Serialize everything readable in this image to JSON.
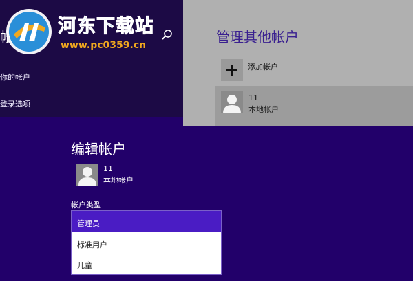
{
  "sidebar": {
    "title": "帐户",
    "items": [
      {
        "label": "你的帐户"
      },
      {
        "label": "登录选项"
      }
    ]
  },
  "watermark": {
    "title": "河东下载站",
    "url": "www.pc0359.cn"
  },
  "manage": {
    "heading": "管理其他帐户",
    "add_label": "添加帐户",
    "accounts": [
      {
        "name": "11",
        "type": "本地帐户"
      }
    ]
  },
  "edit": {
    "title": "编辑帐户",
    "user": {
      "name": "11",
      "type": "本地帐户"
    },
    "field_label": "帐户类型",
    "options": [
      {
        "label": "管理员",
        "selected": true
      },
      {
        "label": "标准用户",
        "selected": false
      },
      {
        "label": "儿童",
        "selected": false
      }
    ]
  },
  "colors": {
    "background": "#22006a",
    "sidebar": "#1c0a45",
    "accent": "#4a1cc4",
    "panel": "#b0b0b0"
  }
}
